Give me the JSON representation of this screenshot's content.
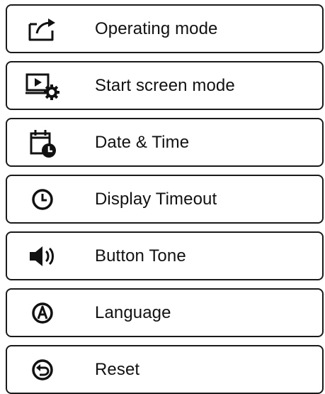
{
  "menu": {
    "items": [
      {
        "label": "Operating mode",
        "icon": "operating-mode-icon"
      },
      {
        "label": "Start screen mode",
        "icon": "start-screen-icon"
      },
      {
        "label": "Date & Time",
        "icon": "calendar-clock-icon"
      },
      {
        "label": "Display Timeout",
        "icon": "clock-icon"
      },
      {
        "label": "Button Tone",
        "icon": "speaker-icon"
      },
      {
        "label": "Language",
        "icon": "language-icon"
      },
      {
        "label": "Reset",
        "icon": "reset-icon"
      }
    ]
  },
  "colors": {
    "border": "#1a1a1a",
    "text": "#111111",
    "background": "#ffffff"
  }
}
